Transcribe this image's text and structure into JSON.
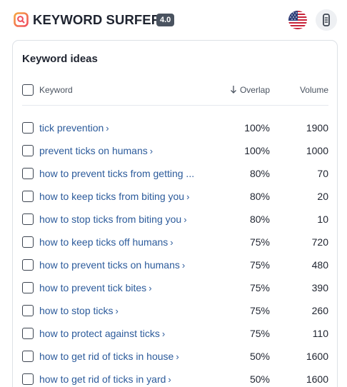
{
  "app": {
    "name": "KEYWORD SURFER",
    "version": "4.0",
    "accent": "#f04e5e",
    "accent2": "#f6a640"
  },
  "header": {
    "flag_icon": "us-flag-icon",
    "menu_icon": "extension-menu-icon"
  },
  "card": {
    "title": "Keyword ideas",
    "columns": {
      "keyword": "Keyword",
      "overlap": "Overlap",
      "volume": "Volume"
    },
    "rows": [
      {
        "keyword": "tick prevention",
        "overlap": "100%",
        "volume": "1900"
      },
      {
        "keyword": "prevent ticks on humans",
        "overlap": "100%",
        "volume": "1000"
      },
      {
        "keyword": "how to prevent ticks from getting ...",
        "overlap": "80%",
        "volume": "70"
      },
      {
        "keyword": "how to keep ticks from biting you",
        "overlap": "80%",
        "volume": "20"
      },
      {
        "keyword": "how to stop ticks from biting you",
        "overlap": "80%",
        "volume": "10"
      },
      {
        "keyword": "how to keep ticks off humans",
        "overlap": "75%",
        "volume": "720"
      },
      {
        "keyword": "how to prevent ticks on humans",
        "overlap": "75%",
        "volume": "480"
      },
      {
        "keyword": "how to prevent tick bites",
        "overlap": "75%",
        "volume": "390"
      },
      {
        "keyword": "how to stop ticks",
        "overlap": "75%",
        "volume": "260"
      },
      {
        "keyword": "how to protect against ticks",
        "overlap": "75%",
        "volume": "110"
      },
      {
        "keyword": "how to get rid of ticks in house",
        "overlap": "50%",
        "volume": "1600"
      },
      {
        "keyword": "how to get rid of ticks in yard",
        "overlap": "50%",
        "volume": "1600"
      }
    ]
  }
}
